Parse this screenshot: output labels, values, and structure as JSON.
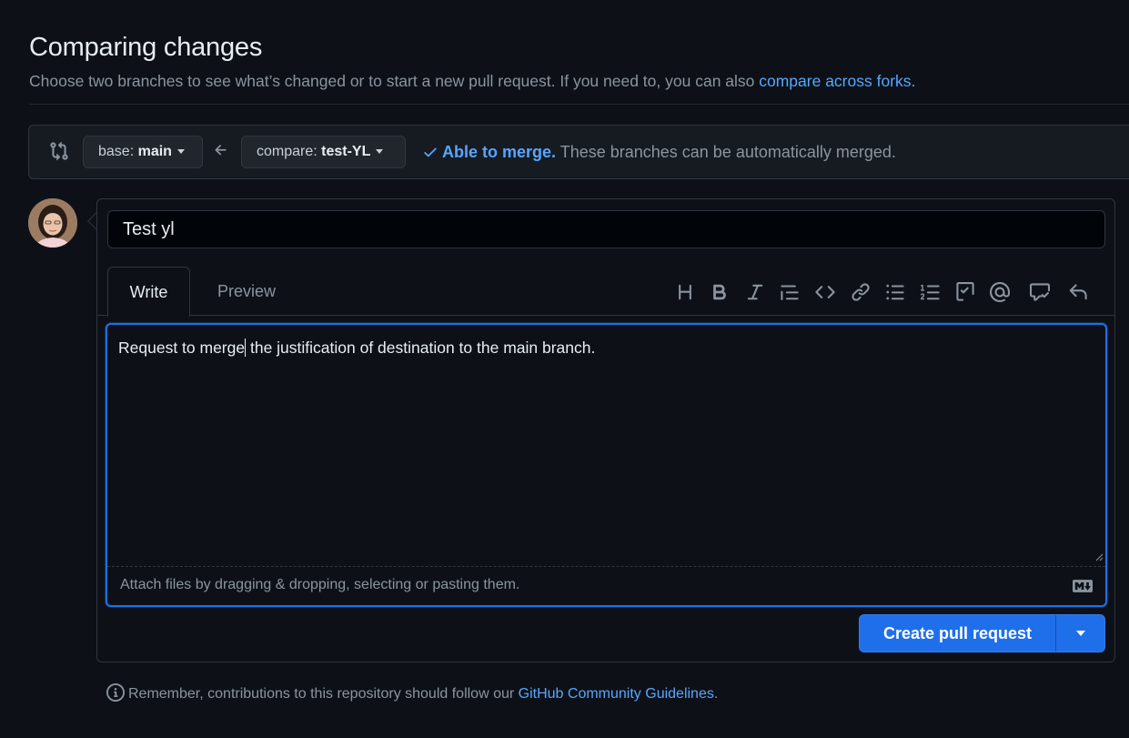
{
  "header": {
    "title": "Comparing changes",
    "subtitle_text": "Choose two branches to see what’s changed or to start a new pull request. If you need to, you can also ",
    "subtitle_link": "compare across forks."
  },
  "range": {
    "base_prefix": "base: ",
    "base_branch": "main",
    "compare_prefix": "compare: ",
    "compare_branch": "test-YL",
    "merge_ok": "Able to merge.",
    "merge_text": " These branches can be automatically merged."
  },
  "form": {
    "title_value": "Test yl",
    "tabs": [
      {
        "label": "Write",
        "active": true
      },
      {
        "label": "Preview",
        "active": false
      }
    ],
    "toolbar_icons": [
      "heading-icon",
      "bold-icon",
      "italic-icon",
      "quote-icon",
      "code-icon",
      "link-icon",
      "bulleted-list-icon",
      "numbered-list-icon",
      "task-list-icon",
      "mention-icon",
      "reference-icon",
      "reply-icon"
    ],
    "body_before_cursor": "Request to merge",
    "body_after_cursor": " the justification of destination to the main branch.",
    "attach_hint": "Attach files by dragging & dropping, selecting or pasting them.",
    "submit_label": "Create pull request"
  },
  "footer": {
    "text": "Remember, contributions to this repository should follow our ",
    "link": "GitHub Community Guidelines",
    "end": "."
  },
  "colors": {
    "background": "#0d1117",
    "accent": "#1f6feb",
    "link": "#58a6ff"
  }
}
